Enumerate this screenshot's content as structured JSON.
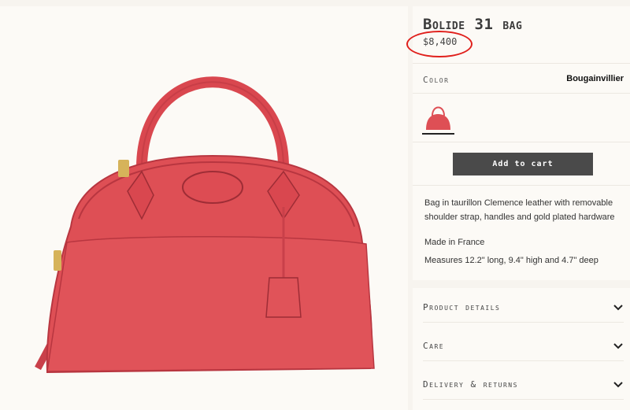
{
  "product": {
    "title": "Bolide 31 bag",
    "price": "$8,400"
  },
  "color": {
    "label": "Color",
    "value": "Bougainvillier",
    "swatch_color": "#de4f55"
  },
  "actions": {
    "add_to_cart": "Add to cart"
  },
  "description": {
    "line1": "Bag in taurillon Clemence leather with removable shoulder strap, handles and gold plated hardware",
    "made_in": "Made in France",
    "measures": "Measures 12.2\" long, 9.4\" high and 4.7\" deep"
  },
  "accordion": [
    {
      "label": "Product details",
      "icon": "chevron-down-icon"
    },
    {
      "label": "Care",
      "icon": "chevron-down-icon"
    },
    {
      "label": "Delivery & returns",
      "icon": "chevron-down-icon"
    }
  ],
  "colors": {
    "bag": "#de4f55",
    "bag_dark": "#b83640",
    "hardware": "#d6b35a",
    "button": "#4a4a4a",
    "annotation": "#e0201c"
  }
}
